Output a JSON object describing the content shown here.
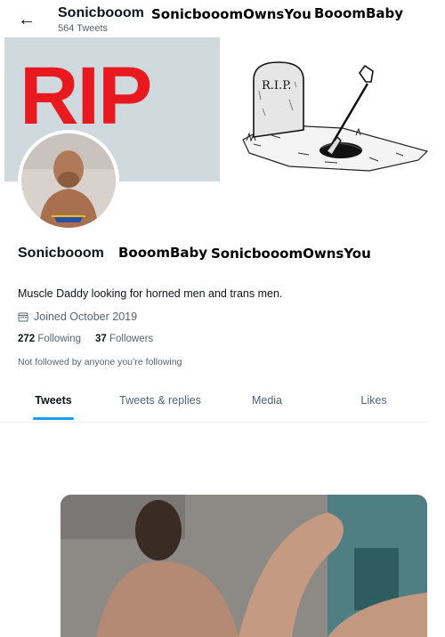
{
  "header": {
    "name": "Sonicbooom",
    "tweet_count": "564 Tweets"
  },
  "overlays": {
    "header_1": "SonicbooomOwnsYou",
    "header_2": "BooomBaby",
    "profile_1": "BooomBaby",
    "profile_2": "SonicbooomOwnsYou"
  },
  "banner": {
    "rip_text": "RIP",
    "gravestone_text": "R.I.P."
  },
  "profile": {
    "name": "Sonicbooom",
    "bio": "Muscle Daddy looking for horned men and trans men.",
    "joined": "Joined October 2019",
    "following_count": "272",
    "following_label": "Following",
    "followers_count": "37",
    "followers_label": "Followers",
    "followed_by": "Not followed by anyone you’re following"
  },
  "tabs": [
    {
      "label": "Tweets"
    },
    {
      "label": "Tweets & replies"
    },
    {
      "label": "Media"
    },
    {
      "label": "Likes"
    }
  ],
  "colors": {
    "accent": "#1d9bf0",
    "rip_red": "#e8191f",
    "banner_bg": "#cfd9de"
  }
}
